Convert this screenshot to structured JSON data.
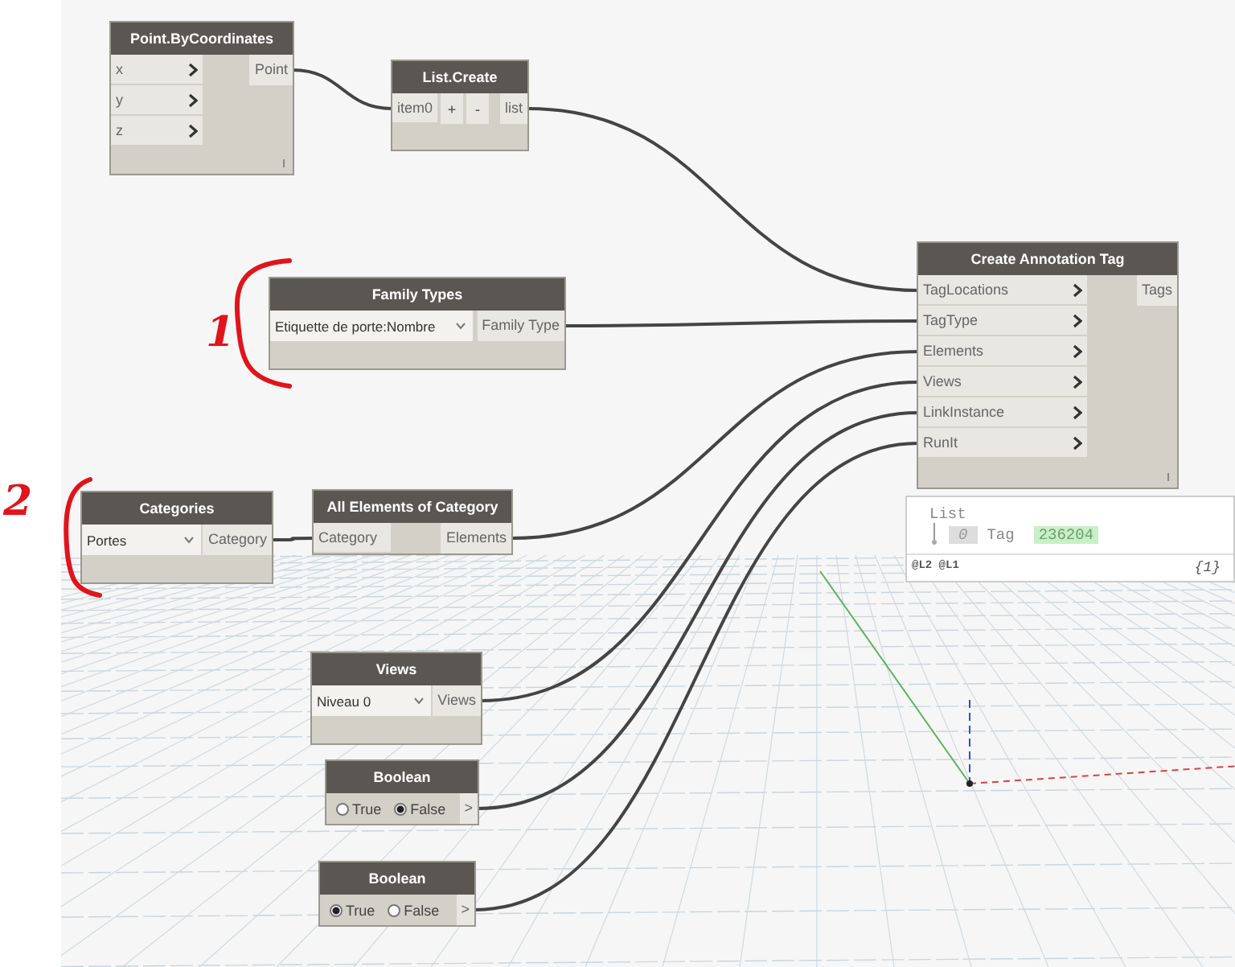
{
  "nodes": [
    {
      "kind": "code",
      "title": "Point.ByCoordinates",
      "inputs": [
        "x",
        "y",
        "z"
      ],
      "outputs": [
        "Point"
      ],
      "chevrons": true,
      "lacing": true
    },
    {
      "kind": "list",
      "title": "List.Create",
      "inputs": [
        "item0"
      ],
      "buttons": [
        "+",
        "-"
      ],
      "outputs": [
        "list"
      ]
    },
    {
      "kind": "dropdown",
      "title": "Family Types",
      "value": "Etiquette de porte:Nombre",
      "outputs": [
        "Family Type"
      ]
    },
    {
      "kind": "code",
      "title": "Create Annotation Tag",
      "inputs": [
        "TagLocations",
        "TagType",
        "Elements",
        "Views",
        "LinkInstance",
        "RunIt"
      ],
      "outputs": [
        "Tags"
      ],
      "chevrons": true,
      "lacing": true
    },
    {
      "kind": "dropdown",
      "title": "Categories",
      "value": "Portes",
      "outputs": [
        "Category"
      ]
    },
    {
      "kind": "code",
      "title": "All Elements of Category",
      "inputs": [
        "Category"
      ],
      "outputs": [
        "Elements"
      ],
      "chevrons": false,
      "lacing": false
    },
    {
      "kind": "watch",
      "root": "List",
      "items": [
        {
          "index": "0",
          "label": "Tag",
          "value": "236204"
        }
      ],
      "levels": "@L2 @L1",
      "count": "{1}"
    },
    {
      "kind": "dropdown",
      "title": "Views",
      "value": "Niveau 0",
      "outputs": [
        "Views"
      ]
    },
    {
      "kind": "boolean",
      "title": "Boolean",
      "options": [
        {
          "label": "True",
          "selected": false
        },
        {
          "label": "False",
          "selected": true
        }
      ],
      "outputs": [
        ">"
      ]
    },
    {
      "kind": "boolean",
      "title": "Boolean",
      "options": [
        {
          "label": "True",
          "selected": true
        },
        {
          "label": "False",
          "selected": false
        }
      ],
      "outputs": [
        ">"
      ]
    }
  ],
  "annotations": [
    {
      "text": "1"
    },
    {
      "text": "2"
    }
  ]
}
